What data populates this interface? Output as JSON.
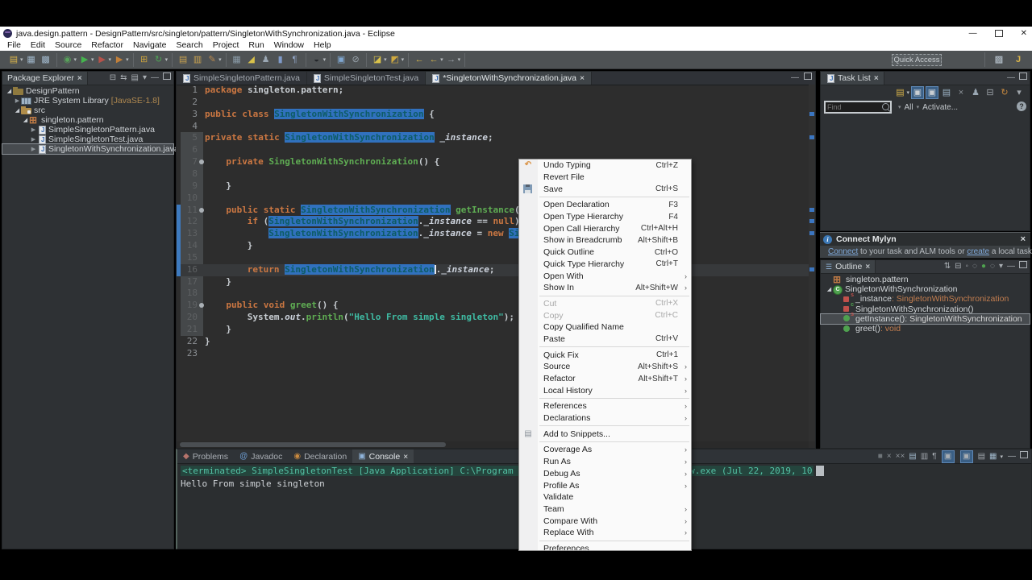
{
  "window": {
    "title": "java.design.pattern - DesignPattern/src/singleton/pattern/SingletonWithSynchronization.java - Eclipse",
    "controls": [
      "minimize",
      "restore",
      "close"
    ]
  },
  "menubar": {
    "items": [
      "File",
      "Edit",
      "Source",
      "Refactor",
      "Navigate",
      "Search",
      "Project",
      "Run",
      "Window",
      "Help"
    ]
  },
  "toolbar": {
    "quick_access": "Quick Access",
    "groups": [
      [
        {
          "n": "new-wizard",
          "g": "▤",
          "c": "#d9b44a",
          "caret": 1
        },
        {
          "n": "save",
          "g": "▦",
          "c": "#9fb6c9"
        },
        {
          "n": "save-all",
          "g": "▩",
          "c": "#9fb6c9"
        }
      ],
      [
        {
          "n": "debug",
          "g": "◉",
          "c": "#57a05a",
          "caret": 1
        },
        {
          "n": "run",
          "g": "▶",
          "c": "#45b34e",
          "caret": 1
        },
        {
          "n": "coverage",
          "g": "▶",
          "c": "#b5524a",
          "caret": 1
        },
        {
          "n": "profile",
          "g": "▶",
          "c": "#c07f3a",
          "caret": 1
        }
      ],
      [
        {
          "n": "new-junit",
          "g": "⊞",
          "c": "#c9a23f"
        },
        {
          "n": "refresh",
          "g": "↻",
          "c": "#4fa455",
          "caret": 1
        }
      ],
      [
        {
          "n": "open-type",
          "g": "▤",
          "c": "#c9a24f"
        },
        {
          "n": "import",
          "g": "▥",
          "c": "#c9a24f"
        },
        {
          "n": "edit",
          "g": "✎",
          "c": "#bc8a4d",
          "caret": 1
        }
      ],
      [
        {
          "n": "breakpoints",
          "g": "▦",
          "c": "#8a9ba8"
        },
        {
          "n": "java-search",
          "g": "◢",
          "c": "#d9c24a"
        },
        {
          "n": "team",
          "g": "♟",
          "c": "#9aa7b3"
        },
        {
          "n": "plugin",
          "g": "▮",
          "c": "#7f9ac9"
        },
        {
          "n": "formatting",
          "g": "¶",
          "c": "#93a7c9"
        }
      ],
      [
        {
          "n": "last-edit-location",
          "g": "◒",
          "c": "#23262a",
          "caret": 1
        }
      ],
      [
        {
          "n": "new-window",
          "g": "▣",
          "c": "#7fa6d0"
        },
        {
          "n": "external-tools",
          "g": "⊘",
          "c": "#9aa4ad"
        }
      ],
      [
        {
          "n": "new-java-class",
          "g": "◪",
          "c": "#d9c24a",
          "caret": 1
        },
        {
          "n": "new-java-package",
          "g": "◩",
          "c": "#cfa93f",
          "caret": 1
        }
      ],
      [
        {
          "n": "previous-edit",
          "g": "←",
          "c": "#d9b84a"
        },
        {
          "n": "back-history",
          "g": "←",
          "c": "#d9b84a",
          "caret": 1
        },
        {
          "n": "forward-history",
          "g": "→",
          "c": "#9aa1a8",
          "caret": 1
        }
      ]
    ],
    "right_icons": [
      {
        "n": "open-perspective",
        "g": "▨",
        "c": "#a9b4bd"
      },
      {
        "n": "java-perspective",
        "g": "J",
        "c": "#d9b44a"
      }
    ]
  },
  "package_explorer": {
    "title": "Package Explorer",
    "header_icons": [
      {
        "n": "collapse-all",
        "g": "⊟"
      },
      {
        "n": "link-with-editor",
        "g": "⇆"
      },
      {
        "n": "focus",
        "g": "▤"
      },
      {
        "n": "view-menu",
        "g": "▾"
      },
      {
        "n": "minimize",
        "g": "—"
      },
      {
        "n": "maximize",
        "g": "BOX"
      }
    ],
    "tree": [
      {
        "d": 0,
        "exp": "open",
        "icon": "project",
        "label": "DesignPattern"
      },
      {
        "d": 1,
        "exp": "closed",
        "icon": "lib",
        "label": "JRE System Library",
        "suffix": "[JavaSE-1.8]"
      },
      {
        "d": 1,
        "exp": "open",
        "icon": "src",
        "label": "src"
      },
      {
        "d": 2,
        "exp": "open",
        "icon": "pkg",
        "label": "singleton.pattern"
      },
      {
        "d": 3,
        "exp": "closed",
        "icon": "jfile",
        "label": "SimpleSingletonPattern.java"
      },
      {
        "d": 3,
        "exp": "closed",
        "icon": "jfile",
        "label": "SimpleSingletonTest.java"
      },
      {
        "d": 3,
        "exp": "closed",
        "icon": "jfile",
        "label": "SingletonWithSynchronization.java",
        "sel": 1
      }
    ]
  },
  "editor": {
    "tabs": [
      {
        "label": "SimpleSingletonPattern.java"
      },
      {
        "label": "SimpleSingletonTest.java"
      },
      {
        "label": "*SingletonWithSynchronization.java",
        "active": 1,
        "close": 1
      }
    ],
    "lines": [
      {
        "n": 1,
        "i": 0,
        "t": [
          [
            "k",
            "package "
          ],
          [
            "p",
            "singleton.pattern;"
          ]
        ]
      },
      {
        "n": 2,
        "i": 0,
        "t": []
      },
      {
        "n": 3,
        "i": 0,
        "t": [
          [
            "k",
            "public class "
          ],
          [
            "h",
            "SingletonWithSynchronization"
          ],
          [
            "p",
            " {"
          ]
        ]
      },
      {
        "n": 4,
        "i": 0,
        "t": []
      },
      {
        "n": 5,
        "i": 0,
        "rng": 1,
        "t": [
          [
            "k",
            "private static "
          ],
          [
            "h",
            "SingletonWithSynchronization"
          ],
          [
            "p",
            " "
          ],
          [
            "f",
            "_instance"
          ],
          [
            "p",
            ";"
          ]
        ]
      },
      {
        "n": 6,
        "i": 0,
        "rng": 1,
        "t": []
      },
      {
        "n": 7,
        "i": 1,
        "rng": 1,
        "b": 1,
        "t": [
          [
            "k",
            "private "
          ],
          [
            "m",
            "SingletonWithSynchronization"
          ],
          [
            "p",
            "() {"
          ]
        ]
      },
      {
        "n": 8,
        "i": 1,
        "rng": 1,
        "t": []
      },
      {
        "n": 9,
        "i": 1,
        "rng": 1,
        "t": [
          [
            "p",
            "}"
          ]
        ]
      },
      {
        "n": 10,
        "i": 0,
        "rng": 1,
        "t": []
      },
      {
        "n": 11,
        "i": 1,
        "rng": 1,
        "b": 1,
        "t": [
          [
            "k",
            "public static "
          ],
          [
            "h",
            "SingletonWithSynchronization"
          ],
          [
            "p",
            " "
          ],
          [
            "m",
            "getInstance"
          ],
          [
            "p",
            "() {"
          ]
        ]
      },
      {
        "n": 12,
        "i": 2,
        "rng": 1,
        "t": [
          [
            "k",
            "if "
          ],
          [
            "p",
            "("
          ],
          [
            "h",
            "SingletonWithSynchronization"
          ],
          [
            "p",
            "."
          ],
          [
            "f",
            "_instance"
          ],
          [
            "p",
            " == "
          ],
          [
            "k",
            "null"
          ],
          [
            "p",
            ") {"
          ]
        ]
      },
      {
        "n": 13,
        "i": 3,
        "rng": 1,
        "t": [
          [
            "h",
            "SingletonWithSynchronization"
          ],
          [
            "p",
            "."
          ],
          [
            "f",
            "_instance"
          ],
          [
            "p",
            " = "
          ],
          [
            "k",
            "new "
          ],
          [
            "h",
            "SingletonWithSynchronization"
          ],
          [
            "p",
            "();"
          ]
        ]
      },
      {
        "n": 14,
        "i": 2,
        "rng": 1,
        "t": [
          [
            "p",
            "}"
          ]
        ]
      },
      {
        "n": 15,
        "i": 0,
        "rng": 1,
        "t": []
      },
      {
        "n": 16,
        "i": 2,
        "rng": 1,
        "cur": 1,
        "t": [
          [
            "k",
            "return "
          ],
          [
            "h",
            "SingletonWithSynchronization"
          ],
          [
            "x",
            ""
          ],
          [
            "p",
            "."
          ],
          [
            "f",
            "_instance"
          ],
          [
            "p",
            ";"
          ]
        ]
      },
      {
        "n": 17,
        "i": 1,
        "rng": 1,
        "t": [
          [
            "p",
            "}"
          ]
        ]
      },
      {
        "n": 18,
        "i": 0,
        "rng": 1,
        "t": []
      },
      {
        "n": 19,
        "i": 1,
        "rng": 1,
        "b": 1,
        "t": [
          [
            "k",
            "public void "
          ],
          [
            "m",
            "greet"
          ],
          [
            "p",
            "() {"
          ]
        ]
      },
      {
        "n": 20,
        "i": 2,
        "rng": 1,
        "t": [
          [
            "p",
            "System."
          ],
          [
            "f",
            "out"
          ],
          [
            "p",
            "."
          ],
          [
            "m",
            "println"
          ],
          [
            "p",
            "("
          ],
          [
            "s",
            "\"Hello From simple singleton\""
          ],
          [
            "p",
            ");"
          ]
        ]
      },
      {
        "n": 21,
        "i": 1,
        "rng": 1,
        "t": [
          [
            "p",
            "}"
          ]
        ]
      },
      {
        "n": 22,
        "i": 0,
        "t": [
          [
            "p",
            "}"
          ]
        ]
      },
      {
        "n": 23,
        "i": 0,
        "t": []
      }
    ],
    "overview_marks_lines": [
      3,
      5,
      11,
      12,
      13,
      16
    ]
  },
  "context_menu": {
    "items": [
      {
        "label": "Undo Typing",
        "shortcut": "Ctrl+Z",
        "icon": "undo"
      },
      {
        "label": "Revert File"
      },
      {
        "label": "Save",
        "shortcut": "Ctrl+S",
        "icon": "save"
      },
      {
        "sep": 1
      },
      {
        "label": "Open Declaration",
        "shortcut": "F3"
      },
      {
        "label": "Open Type Hierarchy",
        "shortcut": "F4"
      },
      {
        "label": "Open Call Hierarchy",
        "shortcut": "Ctrl+Alt+H"
      },
      {
        "label": "Show in Breadcrumb",
        "shortcut": "Alt+Shift+B"
      },
      {
        "label": "Quick Outline",
        "shortcut": "Ctrl+O"
      },
      {
        "label": "Quick Type Hierarchy",
        "shortcut": "Ctrl+T"
      },
      {
        "label": "Open With",
        "sub": 1
      },
      {
        "label": "Show In",
        "shortcut": "Alt+Shift+W",
        "sub": 1
      },
      {
        "sep": 1
      },
      {
        "label": "Cut",
        "shortcut": "Ctrl+X",
        "dis": 1
      },
      {
        "label": "Copy",
        "shortcut": "Ctrl+C",
        "dis": 1
      },
      {
        "label": "Copy Qualified Name"
      },
      {
        "label": "Paste",
        "shortcut": "Ctrl+V"
      },
      {
        "sep": 1
      },
      {
        "label": "Quick Fix",
        "shortcut": "Ctrl+1"
      },
      {
        "label": "Source",
        "shortcut": "Alt+Shift+S",
        "sub": 1
      },
      {
        "label": "Refactor",
        "shortcut": "Alt+Shift+T",
        "sub": 1
      },
      {
        "label": "Local History",
        "sub": 1
      },
      {
        "sep": 1
      },
      {
        "label": "References",
        "sub": 1
      },
      {
        "label": "Declarations",
        "sub": 1
      },
      {
        "sep": 1
      },
      {
        "label": "Add to Snippets...",
        "icon": "snip"
      },
      {
        "sep": 1
      },
      {
        "label": "Coverage As",
        "sub": 1
      },
      {
        "label": "Run As",
        "sub": 1
      },
      {
        "label": "Debug As",
        "sub": 1
      },
      {
        "label": "Profile As",
        "sub": 1
      },
      {
        "label": "Validate"
      },
      {
        "label": "Team",
        "sub": 1
      },
      {
        "label": "Compare With",
        "sub": 1
      },
      {
        "label": "Replace With",
        "sub": 1
      },
      {
        "sep": 1
      },
      {
        "label": "Preferences"
      }
    ]
  },
  "task_list": {
    "title": "Task List",
    "header_icons": [
      {
        "n": "minimize",
        "g": "—"
      },
      {
        "n": "maximize",
        "g": "BOX"
      }
    ],
    "toolbar_icons": [
      {
        "n": "new-task",
        "g": "▤",
        "c": "#d9b44a",
        "caret": 1
      },
      {
        "n": "categorized",
        "g": "▣",
        "tg": 1
      },
      {
        "n": "scheduled",
        "g": "▣",
        "tg": 1
      },
      {
        "n": "focus-on-workweek",
        "g": "▤",
        "c": "#9fb6c9"
      },
      {
        "n": "filter",
        "g": "×",
        "c": "#8f959b"
      },
      {
        "n": "group-by",
        "g": "♟",
        "c": "#9aa7b3"
      },
      {
        "n": "collapse-all",
        "g": "⊟",
        "c": "#9fa5ab"
      },
      {
        "n": "synchronize",
        "g": "↻",
        "c": "#c98a3f"
      },
      {
        "n": "view-menu",
        "g": "▾",
        "c": "#9fa5ab"
      }
    ],
    "find_placeholder": "Find",
    "filter_all": "All",
    "filter_activate": "Activate...",
    "help": "?"
  },
  "mylyn": {
    "title": "Connect Mylyn",
    "link1": "Connect",
    "mid": " to your task and ALM tools or ",
    "link2": "create",
    "tail": " a local task."
  },
  "outline": {
    "title": "Outline",
    "header_icons": [
      {
        "n": "sort",
        "g": "⇅"
      },
      {
        "n": "collapse-all",
        "g": "⊟"
      },
      {
        "n": "hide-fields",
        "g": "◦"
      },
      {
        "n": "hide-static",
        "g": "◌"
      },
      {
        "n": "hide-non-public",
        "g": "●",
        "c": "#4fa14f"
      },
      {
        "n": "hide-local-types",
        "g": "◌"
      },
      {
        "n": "view-menu",
        "g": "▾"
      },
      {
        "n": "minimize",
        "g": "—"
      },
      {
        "n": "maximize",
        "g": "BOX"
      }
    ],
    "items": [
      {
        "d": 0,
        "icon": "pkg",
        "name": "singleton.pattern"
      },
      {
        "d": 0,
        "exp": "open",
        "icon": "class",
        "name": "SingletonWithSynchronization"
      },
      {
        "d": 1,
        "icon": "field",
        "dec": "s",
        "decc": "#c0504b",
        "name": "_instance",
        "suffix": " : SingletonWithSynchronization"
      },
      {
        "d": 1,
        "icon": "field",
        "dec": "c",
        "decc": "#4fa14f",
        "name": "SingletonWithSynchronization()"
      },
      {
        "d": 1,
        "icon": "meth",
        "dec": "s",
        "decc": "#c0504b",
        "name": "getInstance()",
        "suffix": " : SingletonWithSynchronization",
        "sel": 1
      },
      {
        "d": 1,
        "icon": "meth",
        "name": "greet()",
        "suffix": " : void"
      }
    ]
  },
  "console": {
    "tabs": [
      {
        "label": "Problems",
        "icon": "◆",
        "ic": "#b5736b"
      },
      {
        "label": "Javadoc",
        "icon": "@",
        "ic": "#6fa0d8"
      },
      {
        "label": "Declaration",
        "icon": "◉",
        "ic": "#c98a3f"
      },
      {
        "label": "Console",
        "icon": "▣",
        "ic": "#8fb3d9",
        "active": 1,
        "close": 1
      }
    ],
    "toolbar_icons": [
      {
        "n": "terminate",
        "g": "■",
        "c": "#6e7478"
      },
      {
        "n": "remove-launch",
        "g": "×",
        "c": "#8f959b"
      },
      {
        "n": "remove-all-terminated",
        "g": "××",
        "c": "#8f959b"
      },
      {
        "n": "clear-console",
        "g": "▤",
        "c": "#9fb6c9"
      },
      {
        "n": "scroll-lock",
        "g": "▥",
        "c": "#9fa5ab"
      },
      {
        "n": "word-wrap",
        "g": "¶",
        "c": "#9fa5ab"
      },
      {
        "n": "show-on-stdout",
        "g": "▣",
        "tg": 1
      },
      {
        "n": "show-on-stderr",
        "g": "▣",
        "tg": 1
      },
      {
        "n": "pin-console",
        "g": "▤",
        "c": "#9fa5ab"
      },
      {
        "n": "open-console",
        "g": "▦",
        "c": "#9fb6c9",
        "caret": 1
      },
      {
        "n": "minimize",
        "g": "—",
        "c": "#a9aeb3"
      },
      {
        "n": "maximize",
        "g": "BOX"
      }
    ],
    "header": "<terminated> SimpleSingletonTest [Java Application] C:\\Program Files\\Java\\jre1.8.0_171\\bin\\javaw.exe (Jul 22, 2019, 10",
    "output": "Hello From simple singleton"
  },
  "colors": {
    "occurrence_highlight": "#3171be",
    "keyword": "#cb7742",
    "method_name": "#5fad53",
    "string_literal": "#3fbca4",
    "console_header_text": "#54c2a5",
    "editor_background": "#2d2d2d",
    "toolbar_background": "#4e5254",
    "menu_background": "#fafafa",
    "selection_border": "#8a9096"
  }
}
